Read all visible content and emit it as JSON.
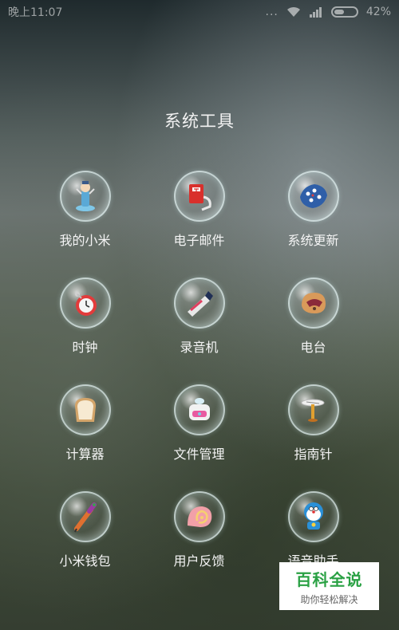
{
  "status_bar": {
    "time": "晚上11:07",
    "dots": "...",
    "battery_percent": "42%"
  },
  "folder": {
    "title": "系统工具",
    "apps": [
      {
        "label": "我的小米",
        "icon": "mi-account-icon"
      },
      {
        "label": "电子邮件",
        "icon": "mailbox-icon"
      },
      {
        "label": "系统更新",
        "icon": "update-pillow-icon"
      },
      {
        "label": "时钟",
        "icon": "clock-icon"
      },
      {
        "label": "录音机",
        "icon": "recorder-icon"
      },
      {
        "label": "电台",
        "icon": "radio-icon"
      },
      {
        "label": "计算器",
        "icon": "calculator-bread-icon"
      },
      {
        "label": "文件管理",
        "icon": "file-manager-icon"
      },
      {
        "label": "指南针",
        "icon": "compass-icon"
      },
      {
        "label": "小米钱包",
        "icon": "wallet-icon"
      },
      {
        "label": "用户反馈",
        "icon": "feedback-icon"
      },
      {
        "label": "语音助手",
        "icon": "voice-assistant-icon"
      }
    ]
  },
  "watermark": {
    "main": "百科全说",
    "sub": "助你轻松解决"
  }
}
